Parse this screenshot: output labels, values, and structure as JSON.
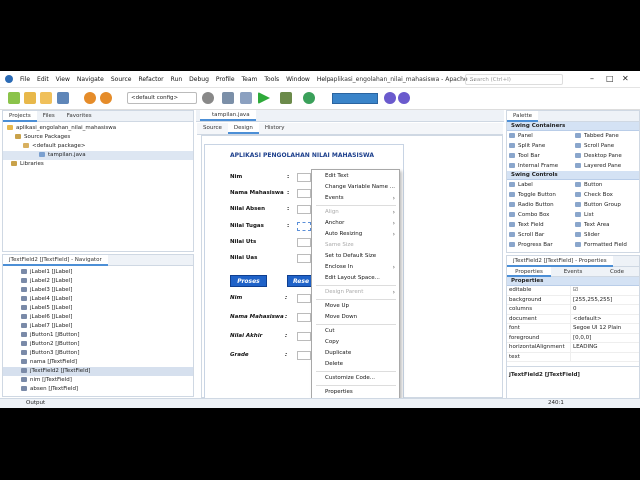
{
  "menu": [
    "File",
    "Edit",
    "View",
    "Navigate",
    "Source",
    "Refactor",
    "Run",
    "Debug",
    "Profile",
    "Team",
    "Tools",
    "Window",
    "Help"
  ],
  "app_title": "aplikasi_engolahan_nilai_mahasiswa - Apache ...",
  "search_placeholder": "Search (Ctrl+I)",
  "config": "<default config>",
  "projects": {
    "tabs": [
      "Projects",
      "Files",
      "Favorites"
    ],
    "tree": [
      "aplikasi_engolahan_nilai_mahasiswa",
      "Source Packages",
      "<default package>",
      "tampilan.java",
      "Libraries"
    ]
  },
  "navigator": {
    "title": "jTextField2 [JTextField] - Navigator",
    "items": [
      "jLabel1 [JLabel]",
      "jLabel2 [JLabel]",
      "jLabel3 [JLabel]",
      "jLabel4 [JLabel]",
      "jLabel5 [JLabel]",
      "jLabel6 [JLabel]",
      "jLabel7 [JLabel]",
      "jButton1 [JButton]",
      "jButton2 [JButton]",
      "jButton3 [JButton]",
      "nama [JTextField]",
      "jTextField2 [JTextField]",
      "nim [JTextField]",
      "absen [JTextField]"
    ]
  },
  "editor": {
    "file_tab": "tampilan.java",
    "view_tabs": [
      "Source",
      "Design",
      "History"
    ]
  },
  "form": {
    "title": "APLIKASI PENGOLAHAN NILAI MAHASISWA",
    "labels": [
      "Nim",
      ":",
      "Nama Mahasiswa",
      ":",
      "Nilai Absen",
      ":",
      "Nilai Tugas",
      ":",
      "Nilai Uts",
      "Nilai Uas"
    ],
    "buttons": [
      "Proses",
      "Rese"
    ],
    "result_labels": [
      "Nim",
      ":",
      "Nama Mahasiswa",
      ":",
      "Nilai Akhir",
      ":",
      "Grade",
      ":"
    ]
  },
  "context_menu": [
    "Edit Text",
    "Change Variable Name ...",
    "Events",
    "Align",
    "Anchor",
    "Auto Resizing",
    "Same Size",
    "Set to Default Size",
    "Enclose In",
    "Edit Layout Space...",
    "Design Parent",
    "Move Up",
    "Move Down",
    "Cut",
    "Copy",
    "Duplicate",
    "Delete",
    "Customize Code...",
    "Properties"
  ],
  "palette": {
    "title": "Palette",
    "containers_title": "Swing Containers",
    "containers": [
      "Panel",
      "Tabbed Pane",
      "Split Pane",
      "Scroll Pane",
      "Tool Bar",
      "Desktop Pane",
      "Internal Frame",
      "Layered Pane"
    ],
    "controls_title": "Swing Controls",
    "controls": [
      "Label",
      "Button",
      "Toggle Button",
      "Check Box",
      "Radio Button",
      "Button Group",
      "Combo Box",
      "List",
      "Text Field",
      "Text Area",
      "Scroll Bar",
      "Slider",
      "Progress Bar",
      "Formatted Field"
    ]
  },
  "properties": {
    "title": "jTextField2 [JTextField] - Properties",
    "tabs": [
      "Properties",
      "Events",
      "Code"
    ],
    "section": "Properties",
    "rows": [
      [
        "editable",
        "☑"
      ],
      [
        "background",
        "[255,255,255]"
      ],
      [
        "columns",
        "0"
      ],
      [
        "document",
        "<default>"
      ],
      [
        "font",
        "Segoe UI 12 Plain"
      ],
      [
        "foreground",
        "[0,0,0]"
      ],
      [
        "horizontalAlignment",
        "LEADING"
      ],
      [
        "text",
        ""
      ]
    ],
    "footer": "jTextField2 [JTextField]"
  },
  "status": {
    "output": "Output",
    "pos": "240:1"
  }
}
